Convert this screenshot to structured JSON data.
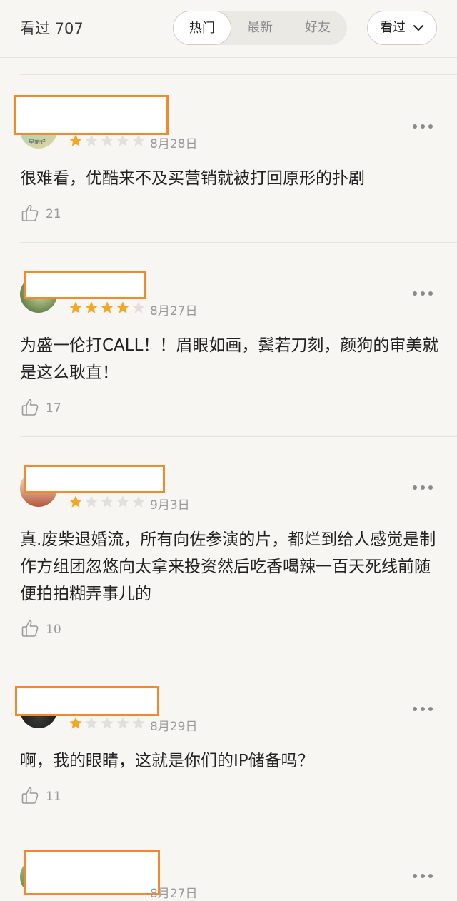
{
  "header": {
    "count_label": "看过 707",
    "tabs": [
      {
        "label": "热门",
        "active": true
      },
      {
        "label": "最新",
        "active": false
      },
      {
        "label": "好友",
        "active": false
      }
    ],
    "filter_label": "看过",
    "filter_icon": "chevron-down-icon"
  },
  "colors": {
    "background": "#f7f6f2",
    "star_on": "#f5a623",
    "star_off": "#e2e0dc",
    "redaction_border": "#f08a2c"
  },
  "reviews": [
    {
      "avatar_text": "星丽好",
      "rating": 1,
      "max_rating": 5,
      "date": "8月28日",
      "text": "很难看，优酷来不及买营销就被打回原形的扑剧",
      "likes": "21"
    },
    {
      "rating": 4,
      "max_rating": 5,
      "date": "8月27日",
      "text": "为盛一伦打CALL！！眉眼如画，鬓若刀刻，颜狗的审美就是这么耿直！",
      "likes": "17"
    },
    {
      "rating": 1,
      "max_rating": 5,
      "date": "9月3日",
      "text": "真.废柴退婚流，所有向佐参演的片，都烂到给人感觉是制作方组团忽悠向太拿来投资然后吃香喝辣一百天死线前随便拍拍糊弄事儿的",
      "likes": "10"
    },
    {
      "rating": 1,
      "max_rating": 5,
      "date": "8月29日",
      "text": "啊，我的眼睛，这就是你们的IP储备吗？",
      "likes": "11"
    },
    {
      "date": "8月27日"
    }
  ]
}
